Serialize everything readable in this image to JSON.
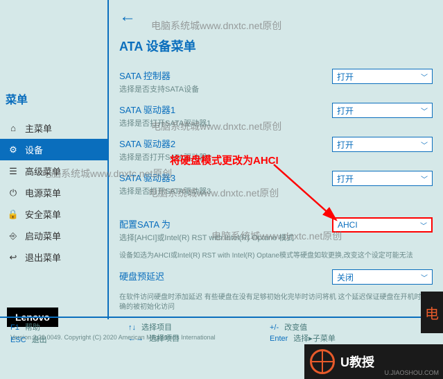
{
  "watermarks": {
    "wm1": "电脑系统城www.dnxtc.net原创",
    "wm2": "电脑系统城www.dnxtc.net原创",
    "wm3": "电脑系统城www.dnxtc.net原创",
    "wm4": "电脑系统城www.dnxtc.net原创",
    "wm5": "电脑系统城www.dnxtc.net原创"
  },
  "sidebar": {
    "title": "菜单",
    "items": [
      {
        "label": "主菜单"
      },
      {
        "label": "设备"
      },
      {
        "label": "高级菜单"
      },
      {
        "label": "电源菜单"
      },
      {
        "label": "安全菜单"
      },
      {
        "label": "启动菜单"
      },
      {
        "label": "退出菜单"
      }
    ]
  },
  "brand": "Lenovo",
  "main": {
    "title": "ATA 设备菜单",
    "settings": [
      {
        "label": "SATA 控制器",
        "desc": "选择是否支持SATA设备",
        "value": "打开"
      },
      {
        "label": "SATA 驱动器1",
        "desc": "选择是否打开SATA驱动器1",
        "value": "打开"
      },
      {
        "label": "SATA 驱动器2",
        "desc": "选择是否打开SATA驱动器2",
        "value": "打开"
      },
      {
        "label": "SATA 驱动器3",
        "desc": "选择是否打开SATA驱动器3",
        "value": "打开"
      }
    ],
    "configure": {
      "label": "配置SATA 为",
      "desc1": "选择[AHCI]或Intel(R) RST with Intel(R) Optane 模式",
      "desc2": "设备如选为AHCI或Intel(R) RST with Intel(R) Optane模式等硬盘如软更换,改变这个设定可能无法",
      "value": "AHCI"
    },
    "delay": {
      "label": "硬盘预延迟",
      "desc": "在软件访问硬盘时添加延迟 有些硬盘在没有足够初始化完毕时访问将机 这个延迟保证硬盘在开机时准确的被初始化访问",
      "value": "关闭"
    }
  },
  "annotation": "将硬盘模式更改为AHCI",
  "footer": {
    "f1": {
      "key": "F1",
      "label": "帮助"
    },
    "esc": {
      "key": "ESC",
      "label": "退出"
    },
    "nav": {
      "key": "↑↓",
      "label": "选择项目"
    },
    "lr": {
      "key": "←→",
      "label": "选择项目"
    },
    "change": {
      "key": "+/-",
      "label": "改变值"
    },
    "enter": {
      "key": "Enter",
      "label": "选择▸子菜单"
    }
  },
  "copyright": "Version 2.20.0049. Copyright (C) 2020 American Megatrends International",
  "logo": {
    "text": "U教授",
    "sub": "U.JIAOSHOU.COM"
  }
}
